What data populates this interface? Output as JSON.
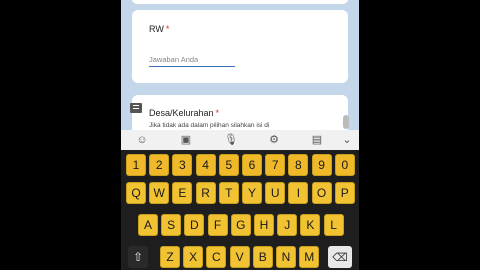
{
  "form": {
    "rw": {
      "title": "RW",
      "required_mark": "*",
      "placeholder": "Jawaban Anda"
    },
    "desa": {
      "title": "Desa/Kelurahan",
      "required_mark": "*",
      "help": "Jika tidak ada dalam pilihan silahkan isi di"
    }
  },
  "toolbar": {
    "icons": [
      "emoji-icon",
      "sticker-icon",
      "microphone-icon",
      "settings-icon",
      "clipboard-icon",
      "chevron-down-icon"
    ],
    "glyphs": [
      "☺",
      "▣",
      "🎙",
      "⚙",
      "▤",
      "⌄"
    ]
  },
  "keyboard": {
    "row_numbers": [
      "1",
      "2",
      "3",
      "4",
      "5",
      "6",
      "7",
      "8",
      "9",
      "0"
    ],
    "row_top": [
      "Q",
      "W",
      "E",
      "R",
      "T",
      "Y",
      "U",
      "I",
      "O",
      "P"
    ],
    "row_mid": [
      "A",
      "S",
      "D",
      "F",
      "G",
      "H",
      "J",
      "K",
      "L"
    ],
    "row_bottom": [
      "Z",
      "X",
      "C",
      "V",
      "B",
      "N",
      "M"
    ],
    "shift_glyph": "⇧",
    "backspace_glyph": "⌫",
    "key_color": "#f1c232"
  }
}
